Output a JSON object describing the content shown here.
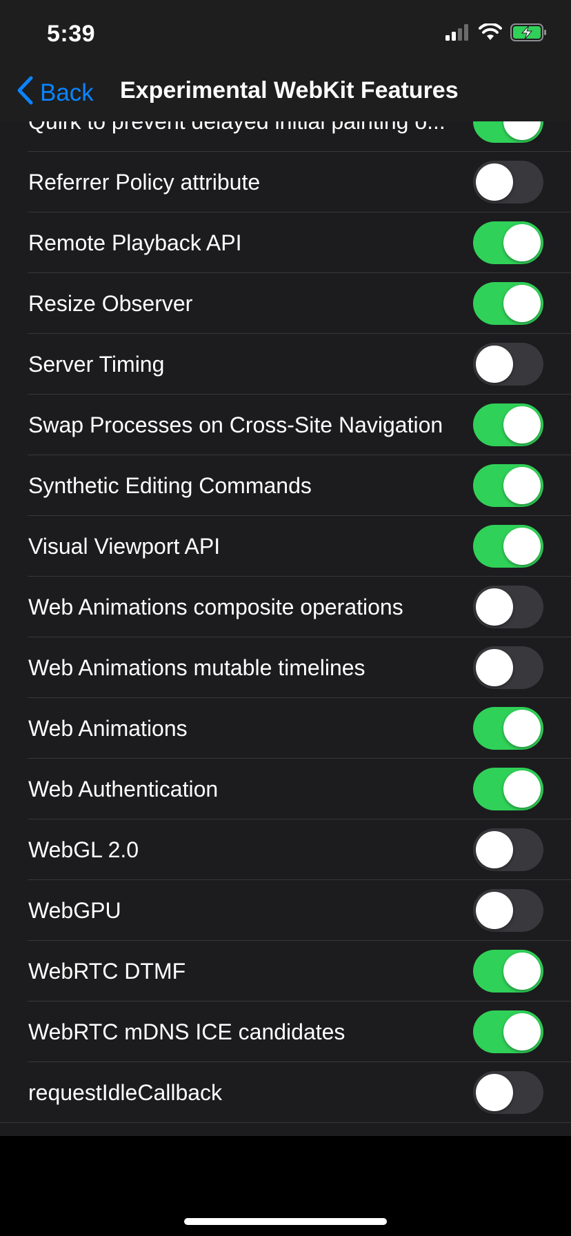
{
  "status_bar": {
    "time": "5:39",
    "icons": [
      "cellular-signal-icon",
      "wifi-icon",
      "battery-charging-icon"
    ],
    "battery_color": "#30d158"
  },
  "navbar": {
    "back_label": "Back",
    "title": "Experimental WebKit Features",
    "accent_color": "#0a84ff"
  },
  "settings": [
    {
      "label": "Quirk to prevent delayed initial painting o...",
      "enabled": true
    },
    {
      "label": "Referrer Policy attribute",
      "enabled": false
    },
    {
      "label": "Remote Playback API",
      "enabled": true
    },
    {
      "label": "Resize Observer",
      "enabled": true
    },
    {
      "label": "Server Timing",
      "enabled": false
    },
    {
      "label": "Swap Processes on Cross-Site Navigation",
      "enabled": true
    },
    {
      "label": "Synthetic Editing Commands",
      "enabled": true
    },
    {
      "label": "Visual Viewport API",
      "enabled": true
    },
    {
      "label": "Web Animations composite operations",
      "enabled": false
    },
    {
      "label": "Web Animations mutable timelines",
      "enabled": false
    },
    {
      "label": "Web Animations",
      "enabled": true
    },
    {
      "label": "Web Authentication",
      "enabled": true
    },
    {
      "label": "WebGL 2.0",
      "enabled": false
    },
    {
      "label": "WebGPU",
      "enabled": false
    },
    {
      "label": "WebRTC DTMF",
      "enabled": true
    },
    {
      "label": "WebRTC mDNS ICE candidates",
      "enabled": true
    },
    {
      "label": "requestIdleCallback",
      "enabled": false
    }
  ],
  "colors": {
    "toggle_on": "#30d158",
    "toggle_off": "#39393d",
    "list_background": "#1c1c1e"
  }
}
